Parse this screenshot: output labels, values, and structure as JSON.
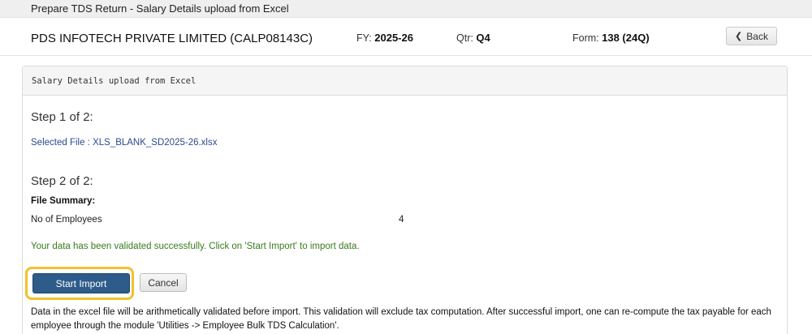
{
  "window": {
    "title": "Prepare TDS Return - Salary Details upload from Excel"
  },
  "header": {
    "company": "PDS INFOTECH PRIVATE LIMITED (CALP08143C)",
    "fy_label": "FY:",
    "fy_value": "2025-26",
    "qtr_label": "Qtr:",
    "qtr_value": "Q4",
    "form_label": "Form:",
    "form_value": "138 (24Q)",
    "back_label": "Back",
    "back_icon": "chevron-left-icon"
  },
  "panel": {
    "title": "Salary Details upload from Excel",
    "step1": {
      "heading": "Step 1 of 2:",
      "selected_file": "Selected File : XLS_BLANK_SD2025-26.xlsx"
    },
    "step2": {
      "heading": "Step 2 of 2:",
      "summary_label": "File Summary:",
      "rows": [
        {
          "label": "No of Employees",
          "value": "4"
        }
      ],
      "success_message": "Your data has been validated successfully. Click on 'Start Import' to import data."
    },
    "buttons": {
      "start_import": "Start Import",
      "cancel": "Cancel"
    },
    "note_line1": "Data in the excel file will be arithmetically validated before import. This validation will exclude tax computation. After successful import, one can re-compute the tax payable for each",
    "note_line2": "employee through the module 'Utilities -> Employee Bulk TDS Calculation'."
  },
  "colors": {
    "primary_button": "#2d5b8a",
    "highlight": "#f2c12e",
    "success_text": "#3a7a1d",
    "link_text": "#2a4a8f"
  }
}
